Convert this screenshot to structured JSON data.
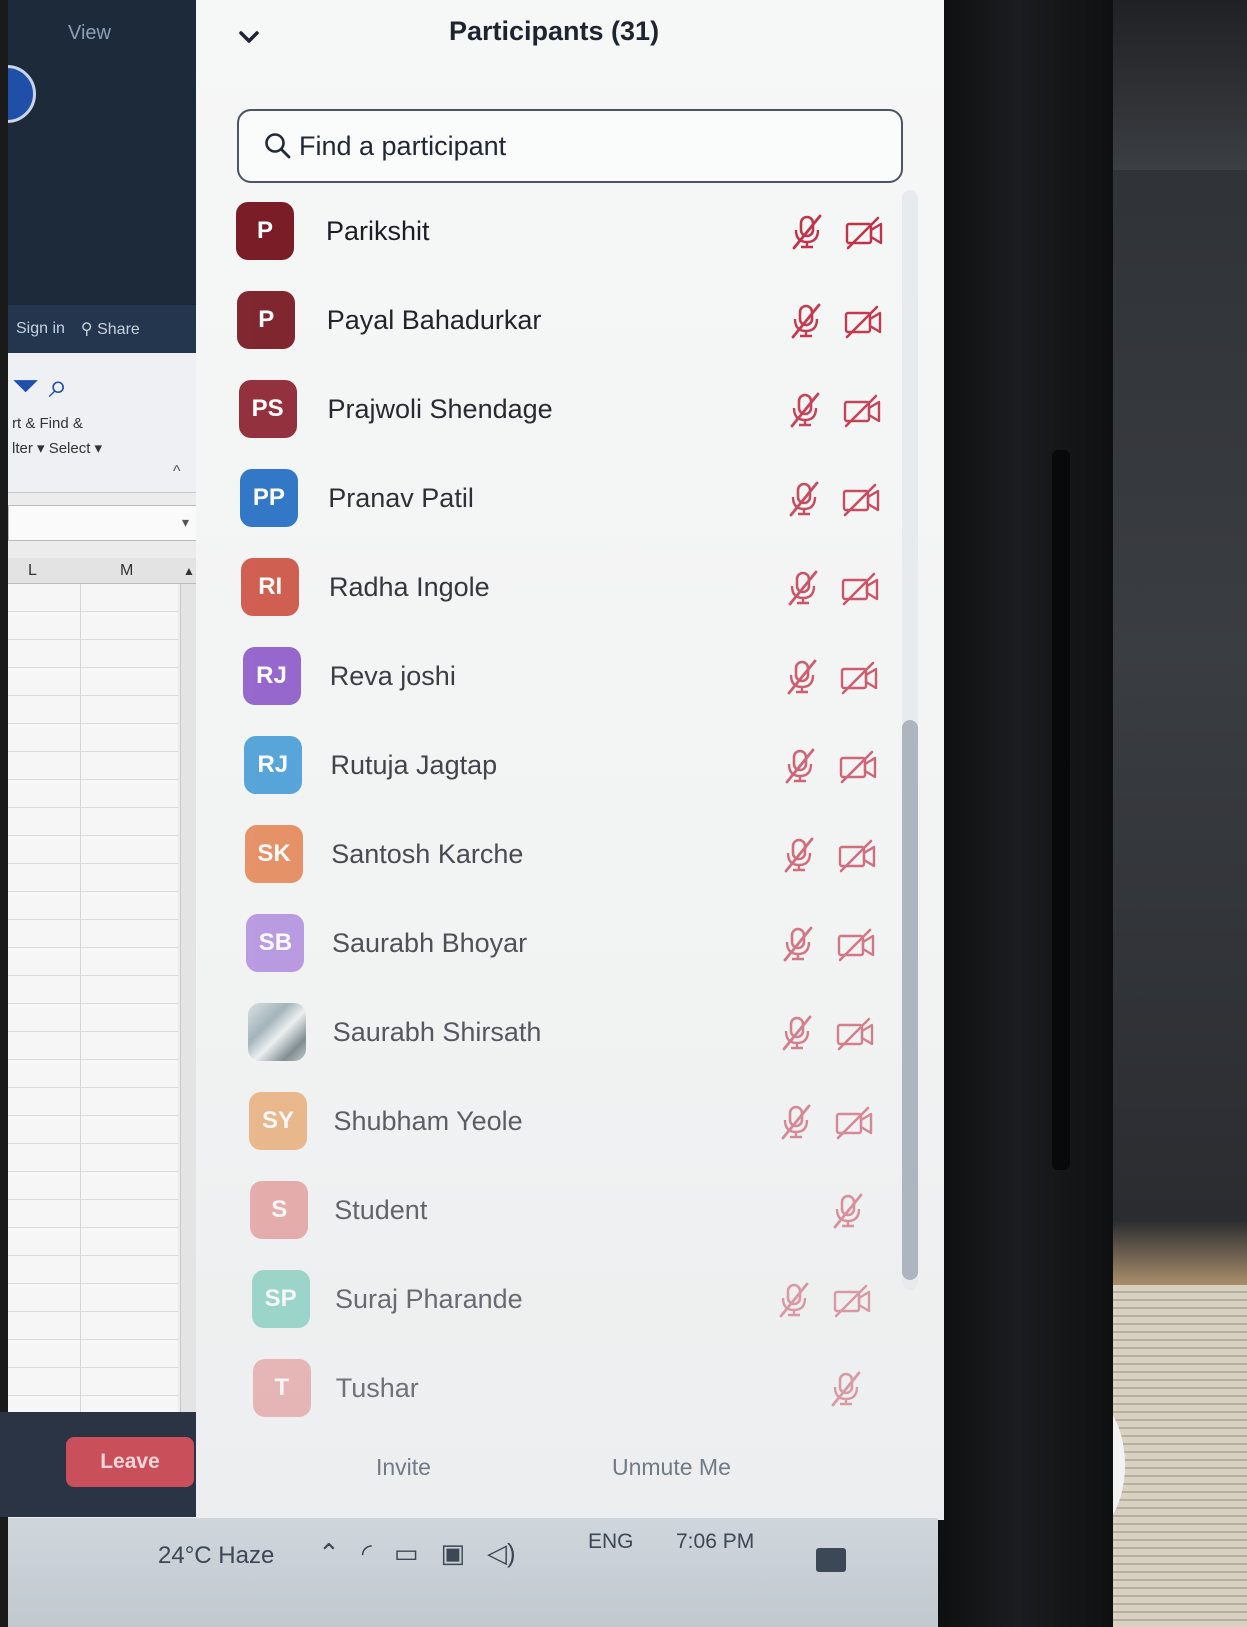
{
  "excel": {
    "menu_view": "View",
    "sign_in": "Sign in",
    "share": "Share",
    "sort_line1": "rt &  Find &",
    "sort_line2": "lter ▾ Select ▾",
    "col_l": "L",
    "col_m": "M"
  },
  "meeting": {
    "leave_label": "Leave",
    "colors": {
      "leave": "#c9505a",
      "muted_icon": "#c0344a"
    }
  },
  "participants_panel": {
    "title": "Participants (31)",
    "search": {
      "placeholder": "Find a participant",
      "value": ""
    },
    "participants": [
      {
        "initials": "P",
        "name": "Parikshit",
        "color": "#7a1d27",
        "audio_muted": true,
        "video_off": true
      },
      {
        "initials": "P",
        "name": "Payal Bahadurkar",
        "color": "#7a1d27",
        "audio_muted": true,
        "video_off": true
      },
      {
        "initials": "PS",
        "name": "Prajwoli Shendage",
        "color": "#8a1f2c",
        "audio_muted": true,
        "video_off": true
      },
      {
        "initials": "PP",
        "name": "Pranav Patil",
        "color": "#1565c0",
        "audio_muted": true,
        "video_off": true
      },
      {
        "initials": "RI",
        "name": "Radha Ingole",
        "color": "#c8402e",
        "audio_muted": true,
        "video_off": true
      },
      {
        "initials": "RJ",
        "name": "Reva joshi",
        "color": "#7c3fc2",
        "audio_muted": true,
        "video_off": true
      },
      {
        "initials": "RJ",
        "name": "Rutuja Jagtap",
        "color": "#1e88d0",
        "audio_muted": true,
        "video_off": true
      },
      {
        "initials": "SK",
        "name": "Santosh Karche",
        "color": "#e0672a",
        "audio_muted": true,
        "video_off": true
      },
      {
        "initials": "SB",
        "name": "Saurabh Bhoyar",
        "color": "#9a6ad8",
        "audio_muted": true,
        "video_off": true
      },
      {
        "initials": "",
        "name": "Saurabh Shirsath",
        "color": "#8fa0a8",
        "photo": true,
        "audio_muted": true,
        "video_off": true
      },
      {
        "initials": "SY",
        "name": "Shubham Yeole",
        "color": "#e5893a",
        "audio_muted": true,
        "video_off": true
      },
      {
        "initials": "S",
        "name": "Student",
        "color": "#dc6a6a",
        "audio_muted": true,
        "video_off": false
      },
      {
        "initials": "SP",
        "name": "Suraj Pharande",
        "color": "#3cb59a",
        "audio_muted": true,
        "video_off": true
      },
      {
        "initials": "T",
        "name": "Tushar",
        "color": "#dd6f6f",
        "audio_muted": true,
        "video_off": false
      }
    ],
    "footer": {
      "invite_label": "Invite",
      "unmute_label": "Unmute Me"
    }
  },
  "taskbar": {
    "weather": "24°C  Haze",
    "language": "ENG",
    "time": "7:06 PM"
  }
}
